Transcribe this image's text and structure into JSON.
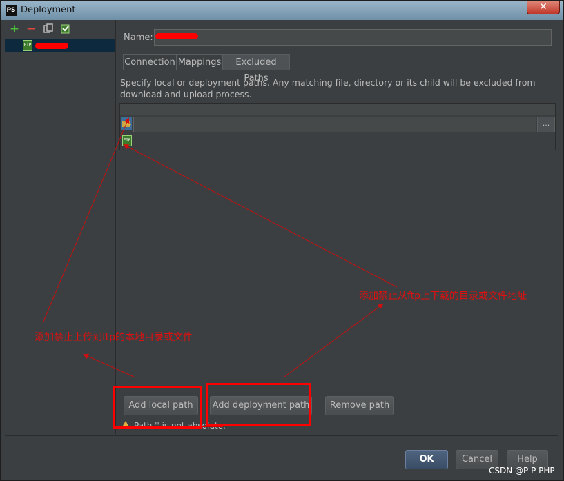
{
  "window": {
    "app_icon": "PS",
    "title": "Deployment",
    "close_symbol": "✕"
  },
  "toolbar": {
    "add_symbol": "+",
    "remove_symbol": "−",
    "copy_icon": "copy-icon",
    "default_icon": "set-default-icon"
  },
  "name_field": {
    "label": "Name:",
    "value": ""
  },
  "tabs": [
    {
      "label": "Connection"
    },
    {
      "label": "Mappings"
    },
    {
      "label": "Excluded Paths"
    }
  ],
  "description": "Specify local or deployment paths. Any matching file, directory or its child will be excluded from download and upload process.",
  "table": {
    "browse_label": "...",
    "ftp_icon": "ftp-server-icon"
  },
  "buttons": {
    "add_local": "Add local path",
    "add_deployment": "Add deployment path",
    "remove": "Remove path"
  },
  "warning": {
    "text": "Path '' is not absolute."
  },
  "dialog_buttons": {
    "ok": "OK",
    "cancel": "Cancel",
    "help": "Help"
  },
  "annotations": {
    "deployment_note": "添加禁止从ftp上下载的目录或文件地址",
    "local_note": "添加禁止上传到ftp的本地目录或文件"
  },
  "watermark": "CSDN @P P PHP",
  "colors": {
    "annotation": "#e01010",
    "selection": "#0d293e",
    "ftp_icon": "#3d7a2c"
  }
}
